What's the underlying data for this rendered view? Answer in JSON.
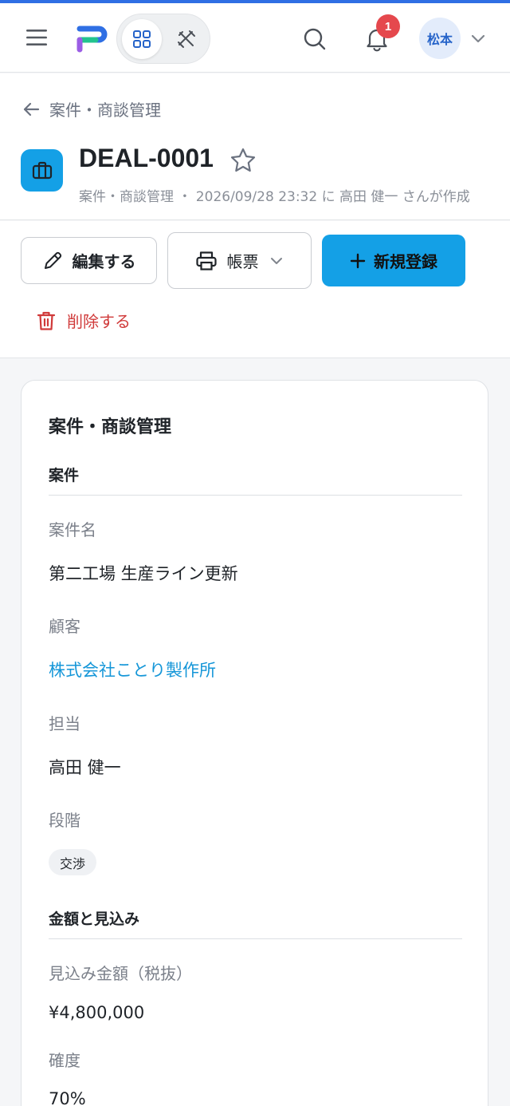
{
  "app": {
    "notifications_count": "1",
    "user_avatar": "松本",
    "colors": {
      "primary": "#14a0e6",
      "accent_bar": "#2f6fe4",
      "danger": "#d03a3a",
      "link": "#1496d8",
      "badge": "#e5484d"
    },
    "icons": [
      "menu-icon",
      "app-logo",
      "grid-icon",
      "tools-icon",
      "search-icon",
      "bell-icon",
      "chevron-down-icon"
    ]
  },
  "header": {
    "breadcrumb": "案件・商談管理",
    "title": "DEAL-0001",
    "meta": "案件・商談管理 ・ 2026/09/28 23:32 に 高田 健一 さんが作成"
  },
  "actions": {
    "edit": "編集する",
    "print": "帳票",
    "new": "新規登録",
    "delete": "削除する"
  },
  "card": {
    "title": "案件・商談管理",
    "sections": [
      {
        "title": "案件",
        "fields": [
          {
            "label": "案件名",
            "value": "第二工場 生産ライン更新"
          },
          {
            "label": "顧客",
            "value": "株式会社ことり製作所"
          },
          {
            "label": "担当",
            "value": "高田 健一"
          },
          {
            "label": "段階",
            "value": "交渉"
          }
        ]
      },
      {
        "title": "金額と見込み",
        "fields": [
          {
            "label": "見込み金額（税抜）",
            "value": "¥4,800,000"
          },
          {
            "label": "確度",
            "value": "70%"
          }
        ]
      }
    ]
  }
}
